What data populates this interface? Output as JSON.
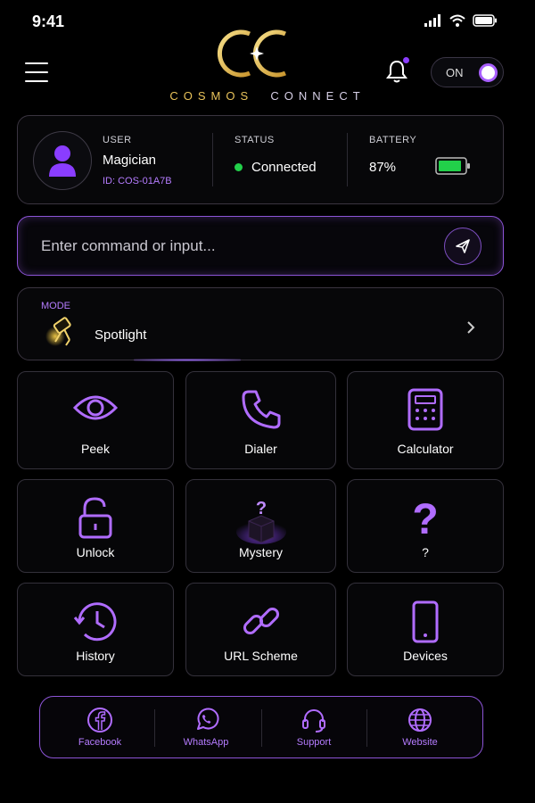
{
  "status_bar": {
    "time": "9:41"
  },
  "header": {
    "brand_word1": "COSMOS",
    "brand_word2": "CONNECT",
    "toggle_label": "ON"
  },
  "info": {
    "user_label": "USER",
    "user_name": "Magician",
    "user_id": "ID: COS-01A7B",
    "status_label": "STATUS",
    "status_value": "Connected",
    "battery_label": "BATTERY",
    "battery_value": "87%"
  },
  "command": {
    "placeholder": "Enter command or input..."
  },
  "mode": {
    "label": "MODE",
    "value": "Spotlight"
  },
  "tiles": [
    {
      "label": "Peek",
      "icon": "eye-icon"
    },
    {
      "label": "Dialer",
      "icon": "phone-icon"
    },
    {
      "label": "Calculator",
      "icon": "calculator-icon"
    },
    {
      "label": "Unlock",
      "icon": "unlock-icon"
    },
    {
      "label": "Mystery",
      "icon": "mystery-box-icon"
    },
    {
      "label": "?",
      "icon": "question-mark-icon"
    },
    {
      "label": "History",
      "icon": "history-icon"
    },
    {
      "label": "URL Scheme",
      "icon": "link-icon"
    },
    {
      "label": "Devices",
      "icon": "smartphone-icon"
    }
  ],
  "bottom_nav": [
    {
      "label": "Facebook",
      "icon": "facebook-icon"
    },
    {
      "label": "WhatsApp",
      "icon": "whatsapp-icon"
    },
    {
      "label": "Support",
      "icon": "headset-icon"
    },
    {
      "label": "Website",
      "icon": "globe-icon"
    }
  ],
  "colors": {
    "accent": "#a960ff",
    "gold": "#e8c25a",
    "connected": "#22d04a",
    "battery_fill": "#22d04a"
  }
}
